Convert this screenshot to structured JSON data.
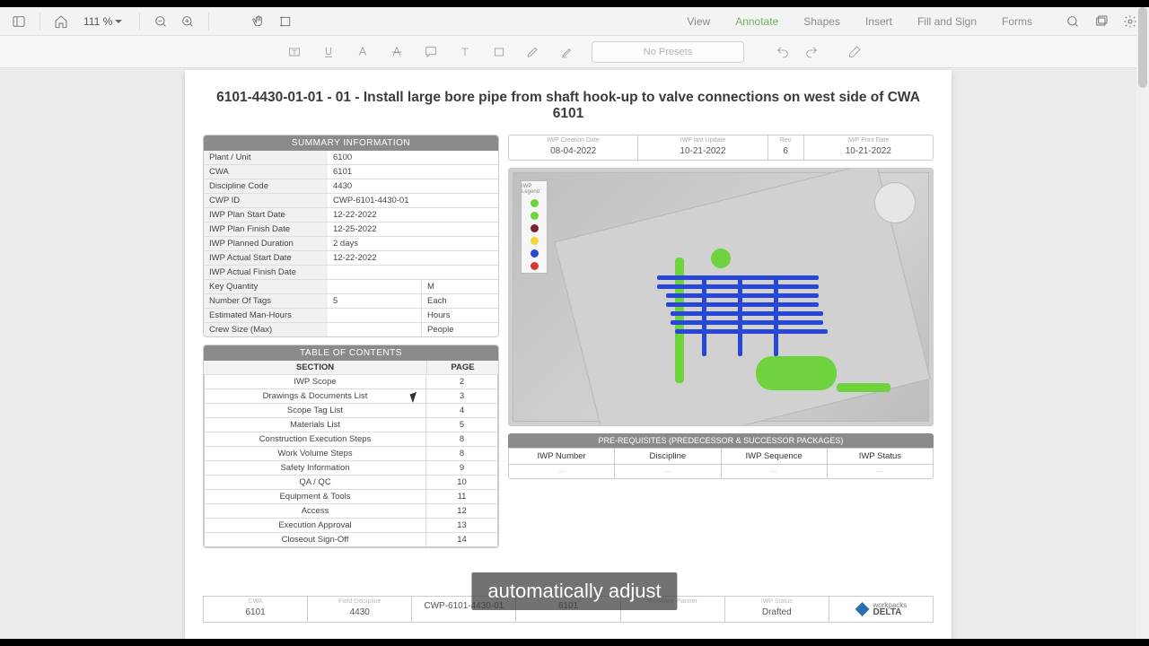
{
  "toolbar": {
    "zoom": "111 %",
    "tabs": [
      "View",
      "Annotate",
      "Shapes",
      "Insert",
      "Fill and Sign",
      "Forms"
    ],
    "active_tab": "Annotate",
    "preset": "No Presets"
  },
  "doc": {
    "title": "6101-4430-01-01 - 01 - Install large bore pipe from shaft hook-up to valve connections on west side of CWA 6101"
  },
  "summary": {
    "header": "SUMMARY INFORMATION",
    "rows": [
      {
        "k": "Plant / Unit",
        "v": "6100"
      },
      {
        "k": "CWA",
        "v": "6101"
      },
      {
        "k": "Discipline Code",
        "v": "4430"
      },
      {
        "k": "CWP ID",
        "v": "CWP-6101-4430-01"
      },
      {
        "k": "IWP Plan Start Date",
        "v": "12-22-2022"
      },
      {
        "k": "IWP Plan Finish Date",
        "v": "12-25-2022"
      },
      {
        "k": "IWP Planned Duration",
        "v": "2 days"
      },
      {
        "k": "IWP Actual Start Date",
        "v": "12-22-2022"
      },
      {
        "k": "IWP Actual Finish Date",
        "v": ""
      },
      {
        "k": "Key Quantity",
        "v": "",
        "u": "M"
      },
      {
        "k": "Number Of Tags",
        "v": "5",
        "u": "Each"
      },
      {
        "k": "Estimated Man-Hours",
        "v": "",
        "u": "Hours"
      },
      {
        "k": "Crew Size (Max)",
        "v": "",
        "u": "People"
      }
    ]
  },
  "toc": {
    "header": "TABLE OF CONTENTS",
    "col_section": "SECTION",
    "col_page": "PAGE",
    "rows": [
      {
        "s": "IWP Scope",
        "p": "2"
      },
      {
        "s": "Drawings & Documents List",
        "p": "3"
      },
      {
        "s": "Scope Tag List",
        "p": "4"
      },
      {
        "s": "Materials List",
        "p": "5"
      },
      {
        "s": "Construction Execution Steps",
        "p": "8"
      },
      {
        "s": "Work Volume Steps",
        "p": "8"
      },
      {
        "s": "Safety Information",
        "p": "9"
      },
      {
        "s": "QA / QC",
        "p": "10"
      },
      {
        "s": "Equipment & Tools",
        "p": "11"
      },
      {
        "s": "Access",
        "p": "12"
      },
      {
        "s": "Execution Approval",
        "p": "13"
      },
      {
        "s": "Closeout Sign-Off",
        "p": "14"
      }
    ]
  },
  "meta": {
    "cells": [
      {
        "lbl": "IWP Creation Date",
        "val": "08-04-2022"
      },
      {
        "lbl": "IWP last Update",
        "val": "10-21-2022"
      },
      {
        "lbl": "Rev",
        "val": "6"
      },
      {
        "lbl": "IWP Print Date",
        "val": "10-21-2022"
      }
    ]
  },
  "legend": {
    "title": "IWP Legend",
    "dots": [
      "#6ed33d",
      "#6ed33d",
      "#7a2030",
      "#f4d63a",
      "#2947d6",
      "#d23a2a"
    ]
  },
  "prereq": {
    "header": "PRE-REQUISITES (PREDECESSOR & SUCCESSOR PACKAGES)",
    "cols": [
      "IWP Number",
      "Discipline",
      "IWP Sequence",
      "IWP Status"
    ]
  },
  "footer": {
    "cells": [
      {
        "lbl": "CWA",
        "val": "6101"
      },
      {
        "lbl": "Field Discipline",
        "val": "4430"
      },
      {
        "lbl": "",
        "val": "CWP-6101-4430-01"
      },
      {
        "lbl": "",
        "val": "6101"
      },
      {
        "lbl": "Workface Planner",
        "val": ""
      },
      {
        "lbl": "IWP Status",
        "val": "Drafted"
      }
    ],
    "brand_top": "workpacks",
    "brand_bottom": "DELTA"
  },
  "caption": "automatically adjust"
}
